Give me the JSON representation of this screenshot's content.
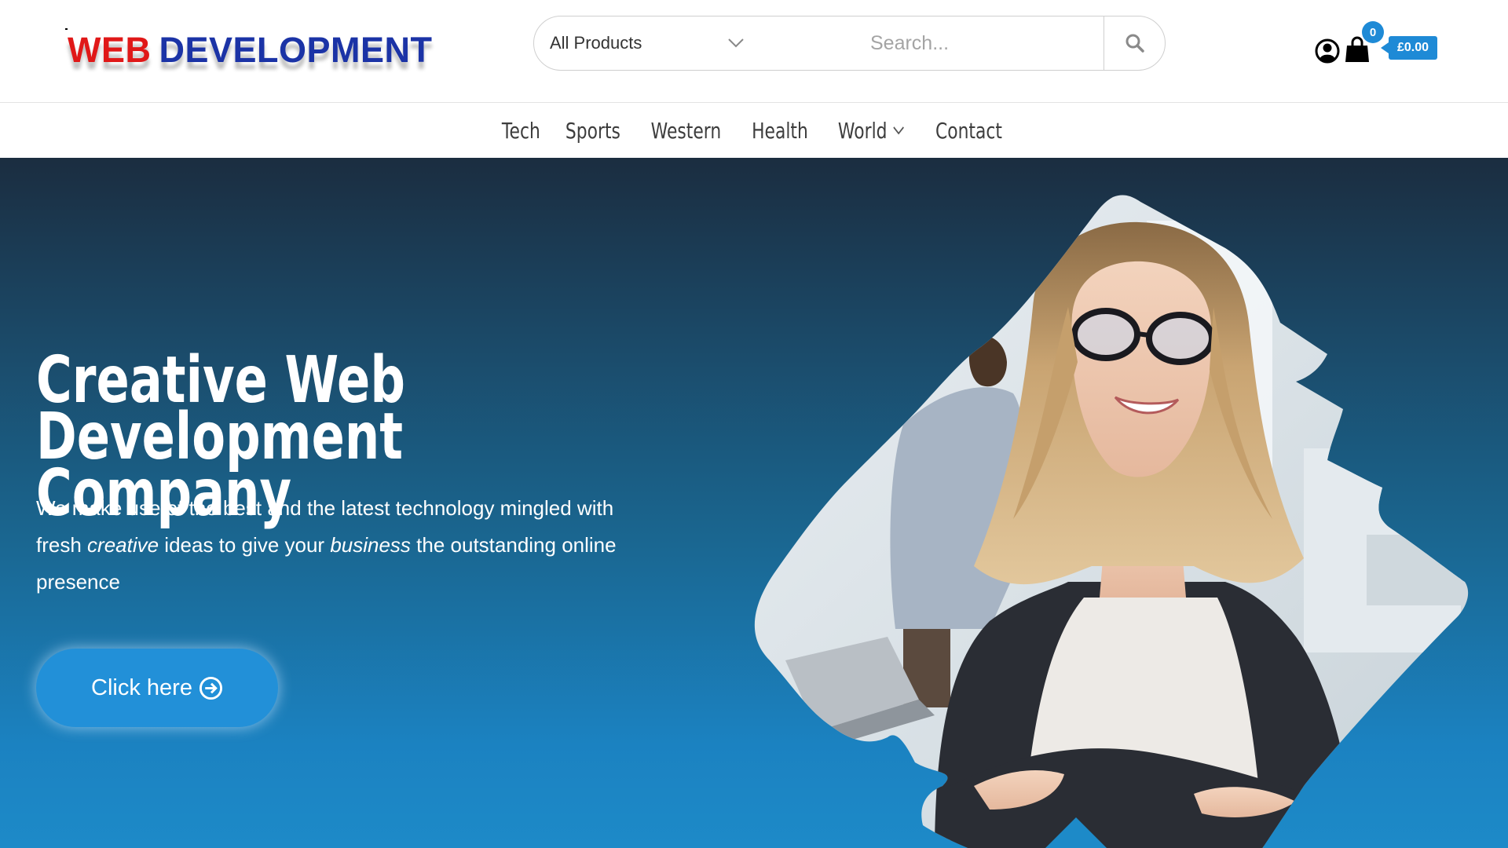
{
  "header": {
    "logo": {
      "part1": "WEB",
      "part2": "DEVELOPMENT"
    },
    "search": {
      "category_selected": "All Products",
      "placeholder": "Search..."
    },
    "cart": {
      "count": "0",
      "total": "£0.00"
    }
  },
  "nav": {
    "items": [
      {
        "label": "Tech"
      },
      {
        "label": "Sports"
      },
      {
        "label": "Western"
      },
      {
        "label": "Health"
      },
      {
        "label": "World",
        "has_dropdown": true
      },
      {
        "label": "Contact"
      }
    ]
  },
  "hero": {
    "title_line1": "Creative Web Development",
    "title_line2": "Company",
    "desc_part1": "We make use of the best and the latest technology mingled with fresh ",
    "desc_em1": "creative",
    "desc_part2": " ideas to give your ",
    "desc_em2": "business",
    "desc_part3": " the outstanding online presence",
    "cta_label": "Click here"
  },
  "colors": {
    "accent": "#1e8ad6",
    "logo_red": "#e01818",
    "logo_blue": "#1b33a6",
    "hero_top": "#1b2d40",
    "hero_bottom": "#1d8ac8"
  },
  "icons": [
    "chevron-down-icon",
    "search-icon",
    "account-icon",
    "shopping-bag-icon",
    "arrow-circle-right-icon"
  ]
}
